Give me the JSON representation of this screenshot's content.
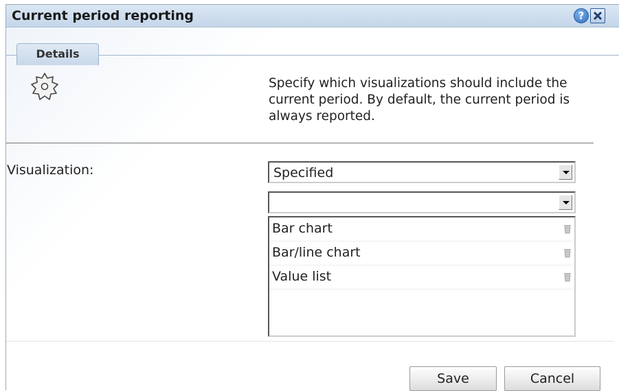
{
  "dialog": {
    "title": "Current period reporting",
    "help_label": "?"
  },
  "tabs": [
    {
      "label": "Details"
    }
  ],
  "description": "Specify which visualizations should include the current period. By default, the current period is always reported.",
  "form": {
    "visualization_label": "Visualization:",
    "mode_select_value": "Specified",
    "add_select_value": "",
    "items": [
      {
        "label": "Bar chart"
      },
      {
        "label": "Bar/line chart"
      },
      {
        "label": "Value list"
      }
    ]
  },
  "buttons": {
    "save": "Save",
    "cancel": "Cancel"
  },
  "icons": {
    "settings": "gear-icon",
    "help": "help-icon",
    "close": "close-icon",
    "delete": "trash-icon",
    "dropdown": "chevron-down-icon"
  }
}
